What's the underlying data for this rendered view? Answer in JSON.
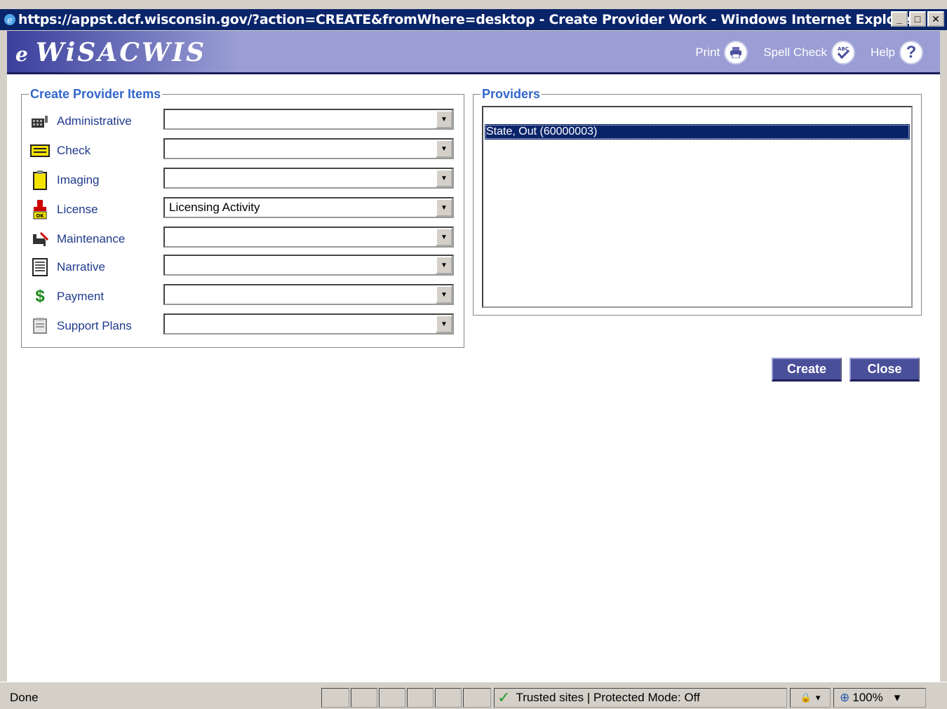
{
  "window": {
    "title": "https://appst.dcf.wisconsin.gov/?action=CREATE&fromWhere=desktop - Create Provider Work - Windows Internet Explorer",
    "minimize": "_",
    "maximize": "□",
    "close": "✕"
  },
  "banner": {
    "logo_prefix": "e",
    "logo": "WiSACWIS",
    "print_label": "Print",
    "spell_check_label": "Spell Check",
    "help_label": "Help"
  },
  "create_items": {
    "legend": "Create Provider Items",
    "rows": [
      {
        "label": "Administrative",
        "value": "",
        "icon": "building-icon"
      },
      {
        "label": "Check",
        "value": "",
        "icon": "check-icon"
      },
      {
        "label": "Imaging",
        "value": "",
        "icon": "clipboard-icon"
      },
      {
        "label": "License",
        "value": "Licensing Activity",
        "icon": "stamp-icon"
      },
      {
        "label": "Maintenance",
        "value": "",
        "icon": "chair-icon"
      },
      {
        "label": "Narrative",
        "value": "",
        "icon": "document-icon"
      },
      {
        "label": "Payment",
        "value": "",
        "icon": "dollar-icon"
      },
      {
        "label": "Support Plans",
        "value": "",
        "icon": "note-icon"
      }
    ]
  },
  "providers": {
    "legend": "Providers",
    "items": [
      "State, Out (60000003)"
    ],
    "selected": "State, Out (60000003)"
  },
  "actions": {
    "create_label": "Create",
    "close_label": "Close"
  },
  "status": {
    "text": "Done",
    "zone": "Trusted sites | Protected Mode: Off",
    "zoom": "100%"
  },
  "colors": {
    "accent": "#3366cc",
    "titlebar": "#0a246a",
    "banner": "#9a9ed4",
    "button": "#4a4f9a"
  }
}
